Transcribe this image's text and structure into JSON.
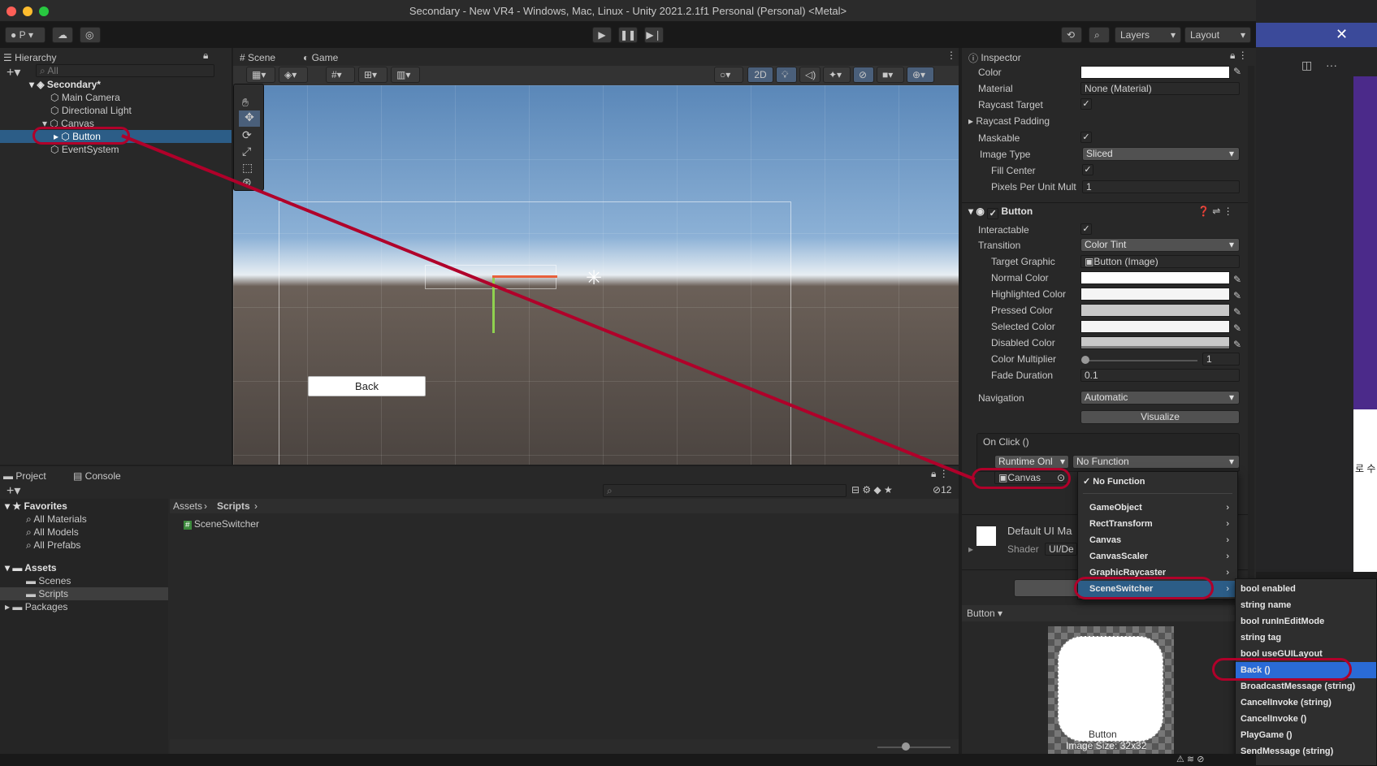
{
  "window": {
    "title": "Secondary - New VR4 - Windows, Mac, Linux - Unity 2021.2.1f1 Personal (Personal) <Metal>"
  },
  "toolbar": {
    "account": "P",
    "layers": "Layers",
    "layout": "Layout"
  },
  "hierarchy": {
    "tab": "Hierarchy",
    "search_placeholder": "All",
    "scene": "Secondary*",
    "items": [
      "Main Camera",
      "Directional Light",
      "Canvas",
      "Button",
      "EventSystem"
    ]
  },
  "scene_view": {
    "tab_scene": "Scene",
    "tab_game": "Game",
    "mode_2d": "2D",
    "back_button": "Back"
  },
  "project": {
    "tab_project": "Project",
    "tab_console": "Console",
    "favorites": "Favorites",
    "favorite_items": [
      "All Materials",
      "All Models",
      "All Prefabs"
    ],
    "assets": "Assets",
    "asset_folders": [
      "Scenes",
      "Scripts"
    ],
    "packages": "Packages",
    "breadcrumb": [
      "Assets",
      "Scripts"
    ],
    "files": [
      "SceneSwitcher"
    ],
    "hidden_count": "12"
  },
  "inspector": {
    "tab": "Inspector",
    "image": {
      "color_label": "Color",
      "material_label": "Material",
      "material_value": "None (Material)",
      "raycast_target": "Raycast Target",
      "raycast_padding": "Raycast Padding",
      "maskable": "Maskable",
      "image_type_label": "Image Type",
      "image_type_value": "Sliced",
      "fill_center": "Fill Center",
      "ppu_label": "Pixels Per Unit Mult",
      "ppu_value": "1"
    },
    "button": {
      "header": "Button",
      "interactable": "Interactable",
      "transition_label": "Transition",
      "transition_value": "Color Tint",
      "target_graphic_label": "Target Graphic",
      "target_graphic_value": "Button (Image)",
      "normal_color": "Normal Color",
      "highlighted_color": "Highlighted Color",
      "pressed_color": "Pressed Color",
      "selected_color": "Selected Color",
      "disabled_color": "Disabled Color",
      "color_multiplier": "Color Multiplier",
      "color_multiplier_value": "1",
      "fade_duration": "Fade Duration",
      "fade_duration_value": "0.1",
      "navigation_label": "Navigation",
      "navigation_value": "Automatic",
      "visualize": "Visualize",
      "onclick": "On Click ()",
      "runtime": "Runtime Onl",
      "function": "No Function",
      "target_object": "Canvas"
    },
    "material": {
      "name": "Default UI Ma",
      "shader_label": "Shader",
      "shader_value": "UI/De"
    },
    "add_partial": "A",
    "preview": {
      "label": "Button",
      "caption": "Button",
      "size": "Image Size: 32x32"
    }
  },
  "function_menu": {
    "selected": "No Function",
    "items": [
      "GameObject",
      "RectTransform",
      "Canvas",
      "CanvasScaler",
      "GraphicRaycaster",
      "SceneSwitcher"
    ]
  },
  "submenu": {
    "items": [
      "bool enabled",
      "string name",
      "bool runInEditMode",
      "string tag",
      "bool useGUILayout",
      "Back ()",
      "BroadcastMessage (string)",
      "CancelInvoke (string)",
      "CancelInvoke ()",
      "PlayGame ()",
      "SendMessage (string)"
    ],
    "highlighted": "Back ()"
  },
  "side_text": "로 수"
}
